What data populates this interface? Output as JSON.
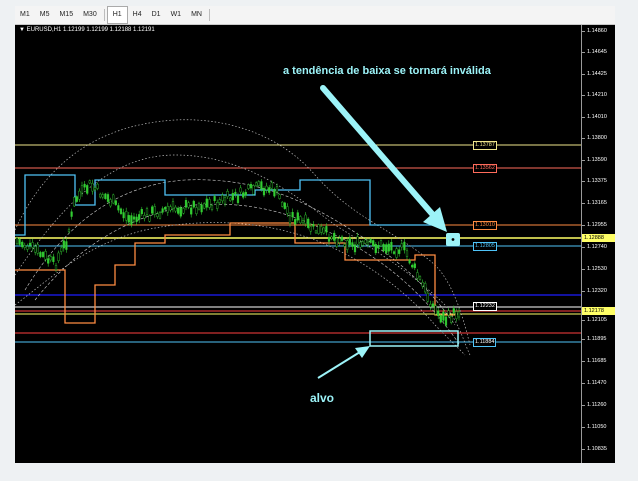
{
  "timeframes": [
    "M1",
    "M5",
    "M15",
    "M30",
    "H1",
    "H4",
    "D1",
    "W1",
    "MN"
  ],
  "active_timeframe": "H1",
  "chart": {
    "symbol_label": "EURUSD,H1",
    "ohlc": "1.12199 1.12199 1.12188 1.12191"
  },
  "price_scale": {
    "ticks": [
      "1.14860",
      "1.14645",
      "1.14425",
      "1.14210",
      "1.14010",
      "1.13800",
      "1.13590",
      "1.13375",
      "1.13165",
      "1.12955",
      "1.12740",
      "1.12530",
      "1.12320",
      "1.12105",
      "1.11895",
      "1.11685",
      "1.11470",
      "1.11260",
      "1.11050",
      "1.10835"
    ],
    "current_price": "1.12178",
    "marked_price": "1.12888"
  },
  "levels": [
    {
      "label": "1.13787",
      "color": "#f0e68c"
    },
    {
      "label": "1.13562",
      "color": "#ff6b5b"
    },
    {
      "label": "1.13010",
      "color": "#ff8c42"
    },
    {
      "label": "1.12805",
      "color": "#4fc3f7"
    },
    {
      "label": "1.12232",
      "color": "#ffffff"
    },
    {
      "label": "1.11884",
      "color": "#ffffff"
    }
  ],
  "annotations": {
    "invalid_trend": "a tendência de baixa se tornará inválida",
    "target": "alvo"
  },
  "colors": {
    "annotation": "#9cf3f8",
    "candles": "#32cd32",
    "band_orange": "#ff8c42",
    "band_blue": "#4fc3f7"
  }
}
